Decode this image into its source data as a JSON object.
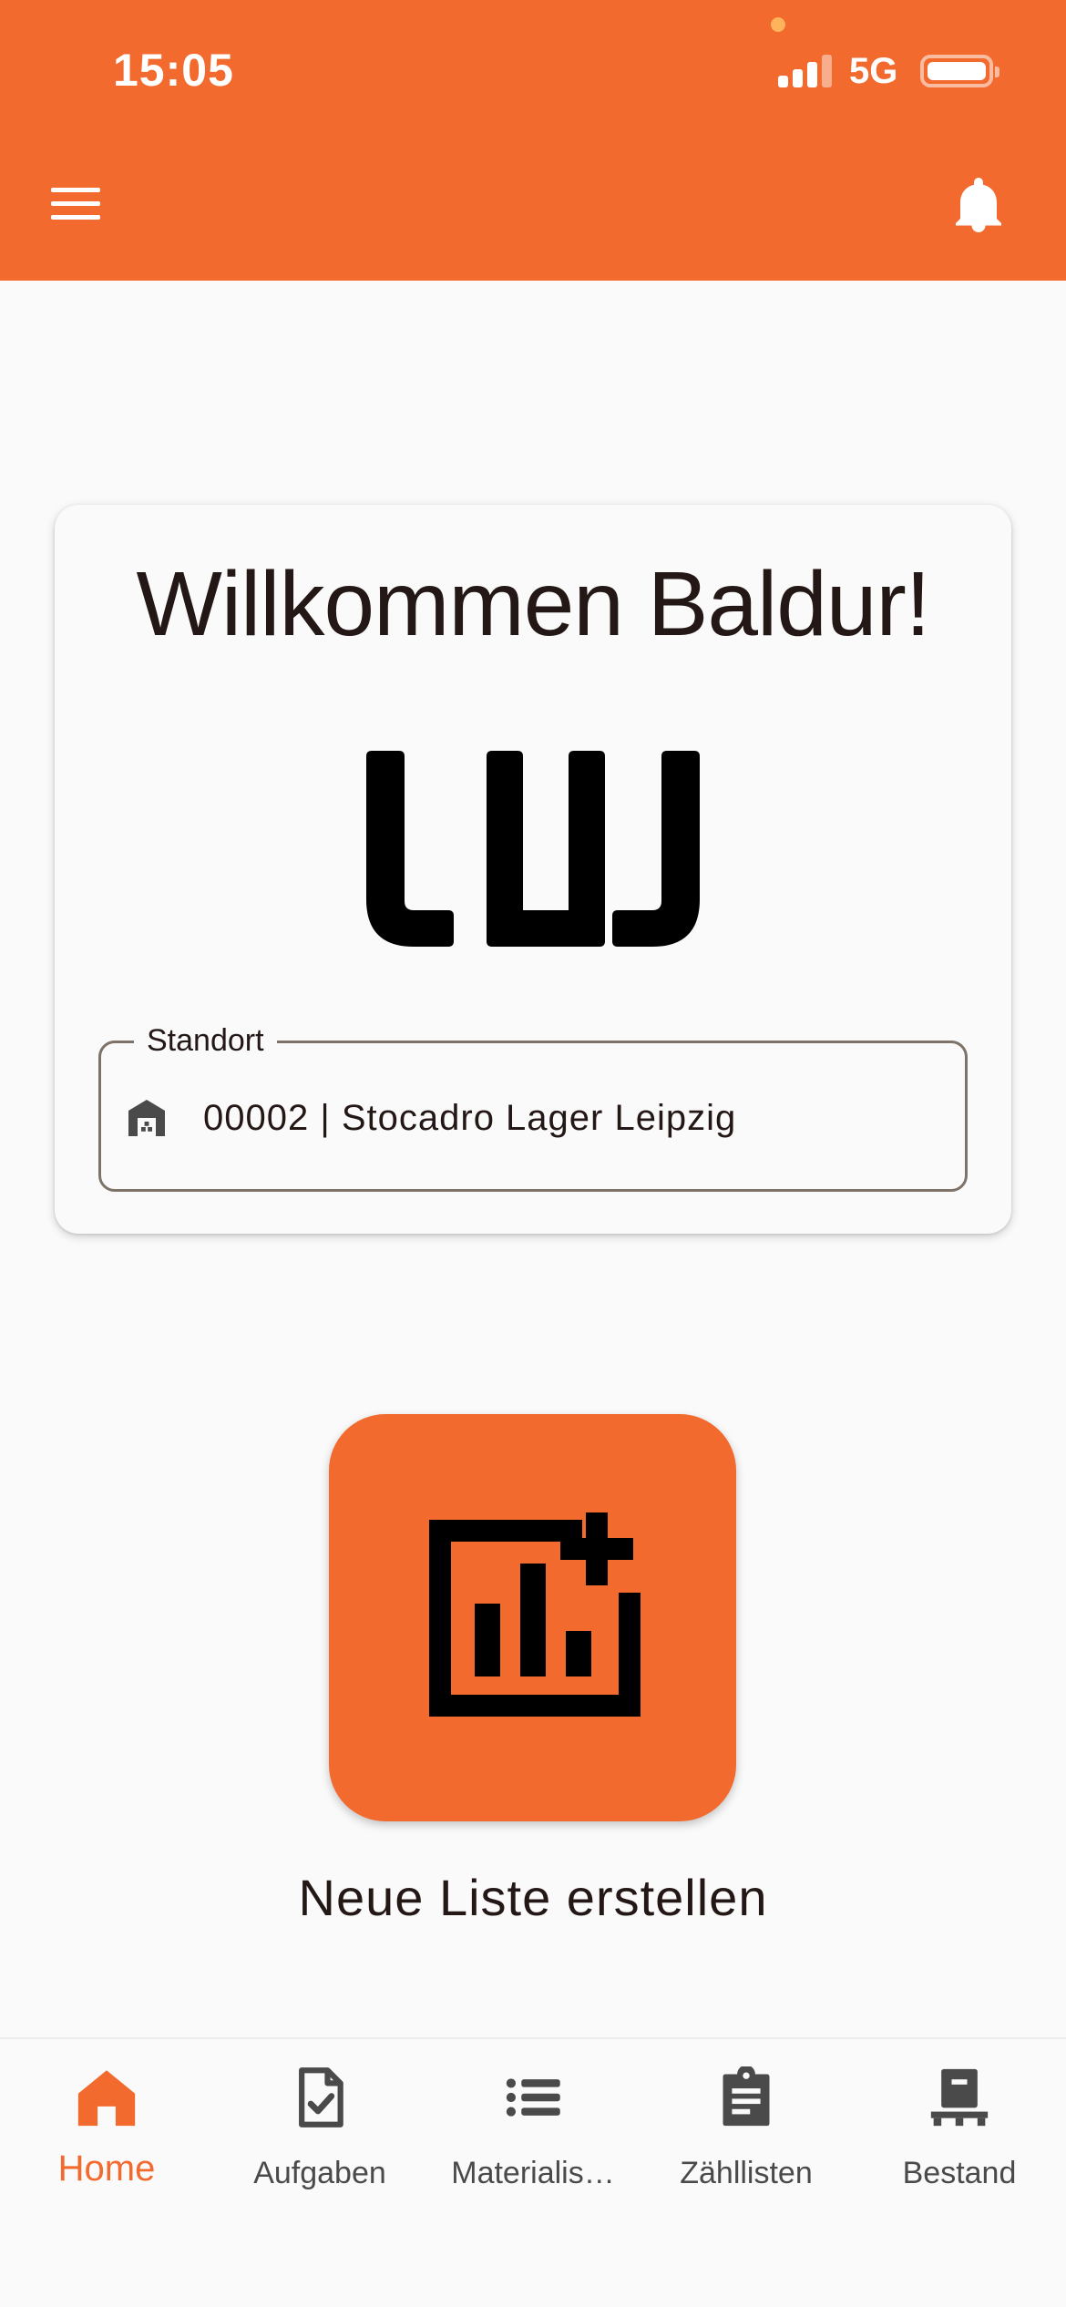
{
  "status_bar": {
    "time": "15:05",
    "network": "5G"
  },
  "app_bar": {
    "menu_icon": "menu-icon",
    "notifications_icon": "bell-icon"
  },
  "colors": {
    "accent": "#F26A2E",
    "background": "#FAFAFA",
    "text": "#231815"
  },
  "welcome_card": {
    "title": "Willkommen Baldur!",
    "logo_icon": "company-logo",
    "location_field": {
      "label": "Standort",
      "value": "00002 | Stocadro Lager Leipzig",
      "icon": "warehouse-icon"
    }
  },
  "primary_action": {
    "label": "Neue Liste erstellen",
    "icon": "chart-add-icon"
  },
  "bottom_nav": {
    "items": [
      {
        "label": "Home",
        "icon": "home-icon",
        "active": true
      },
      {
        "label": "Aufgaben",
        "icon": "task-document-icon",
        "active": false
      },
      {
        "label": "Materialis…",
        "icon": "list-icon",
        "active": false
      },
      {
        "label": "Zähllisten",
        "icon": "clipboard-icon",
        "active": false
      },
      {
        "label": "Bestand",
        "icon": "inventory-pallet-icon",
        "active": false
      }
    ]
  }
}
